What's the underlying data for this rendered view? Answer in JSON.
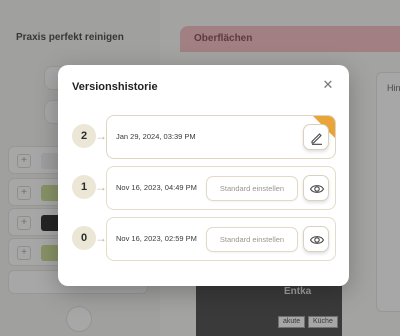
{
  "background": {
    "left_title": "Praxis perfekt reinigen",
    "tab_title": "Oberflächen",
    "right_header": "Hin",
    "photo_caption": "Entka",
    "tags": [
      "akute",
      "Küche"
    ]
  },
  "modal": {
    "title": "Versionshistorie",
    "close_icon": "close-icon",
    "versions": [
      {
        "number": "2",
        "date": "Jan 29, 2024, 03:39 PM",
        "current": true,
        "action_icon": "edit-icon"
      },
      {
        "number": "1",
        "date": "Nov 16, 2023, 04:49 PM",
        "current": false,
        "standard_label": "Standard einstellen",
        "action_icon": "eye-icon"
      },
      {
        "number": "0",
        "date": "Nov 16, 2023, 02:59 PM",
        "current": false,
        "standard_label": "Standard einstellen",
        "action_icon": "eye-icon"
      }
    ]
  },
  "colors": {
    "accent": "#e9a43a",
    "badge_bg": "#ebe6d5",
    "card_border": "#e3ddc8"
  }
}
